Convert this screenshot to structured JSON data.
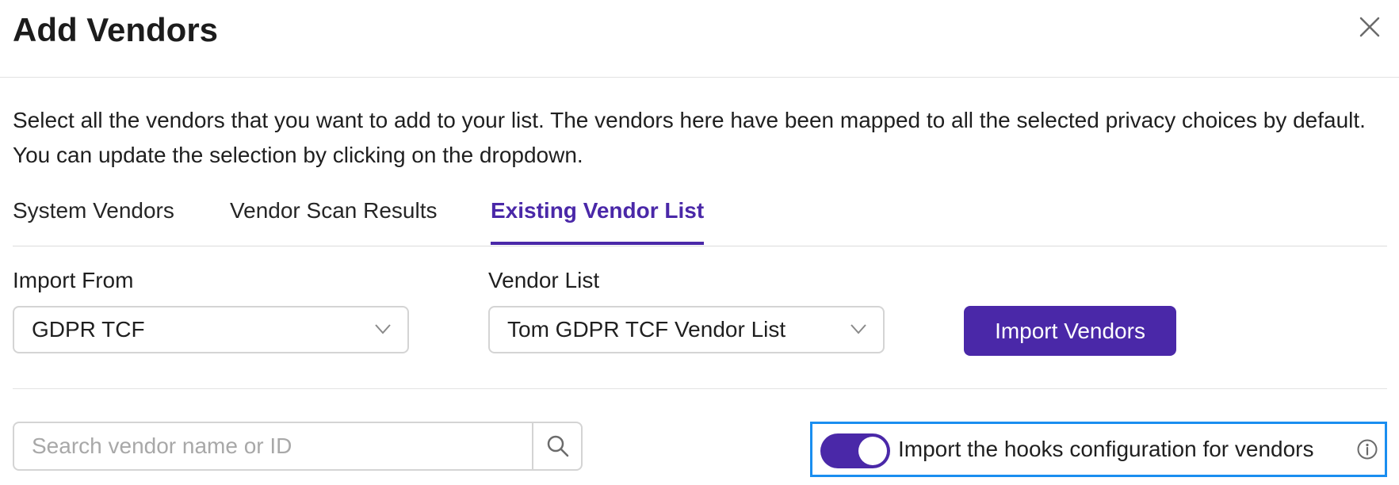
{
  "modal": {
    "title": "Add Vendors",
    "close_icon": "close-icon"
  },
  "description": "Select all the vendors that you want to add to your list. The vendors here have been mapped to all the selected privacy choices by default. You can update the selection by clicking on the dropdown.",
  "tabs": [
    {
      "label": "System Vendors",
      "active": false
    },
    {
      "label": "Vendor Scan Results",
      "active": false
    },
    {
      "label": "Existing Vendor List",
      "active": true
    }
  ],
  "import_form": {
    "import_from": {
      "label": "Import From",
      "value": "GDPR TCF",
      "icon": "chevron-down-icon"
    },
    "vendor_list": {
      "label": "Vendor List",
      "value": "Tom GDPR TCF Vendor List",
      "icon": "chevron-down-icon"
    },
    "import_button_label": "Import Vendors"
  },
  "search": {
    "placeholder": "Search vendor name or ID",
    "value": "",
    "icon": "search-icon"
  },
  "hooks_toggle": {
    "label": "Import the hooks configuration for vendors",
    "enabled": true,
    "info_icon": "info-icon"
  },
  "colors": {
    "accent": "#4a28a8",
    "highlight_border": "#1a8ef0",
    "divider": "#e3e3e3",
    "placeholder": "#a8a8a8"
  }
}
